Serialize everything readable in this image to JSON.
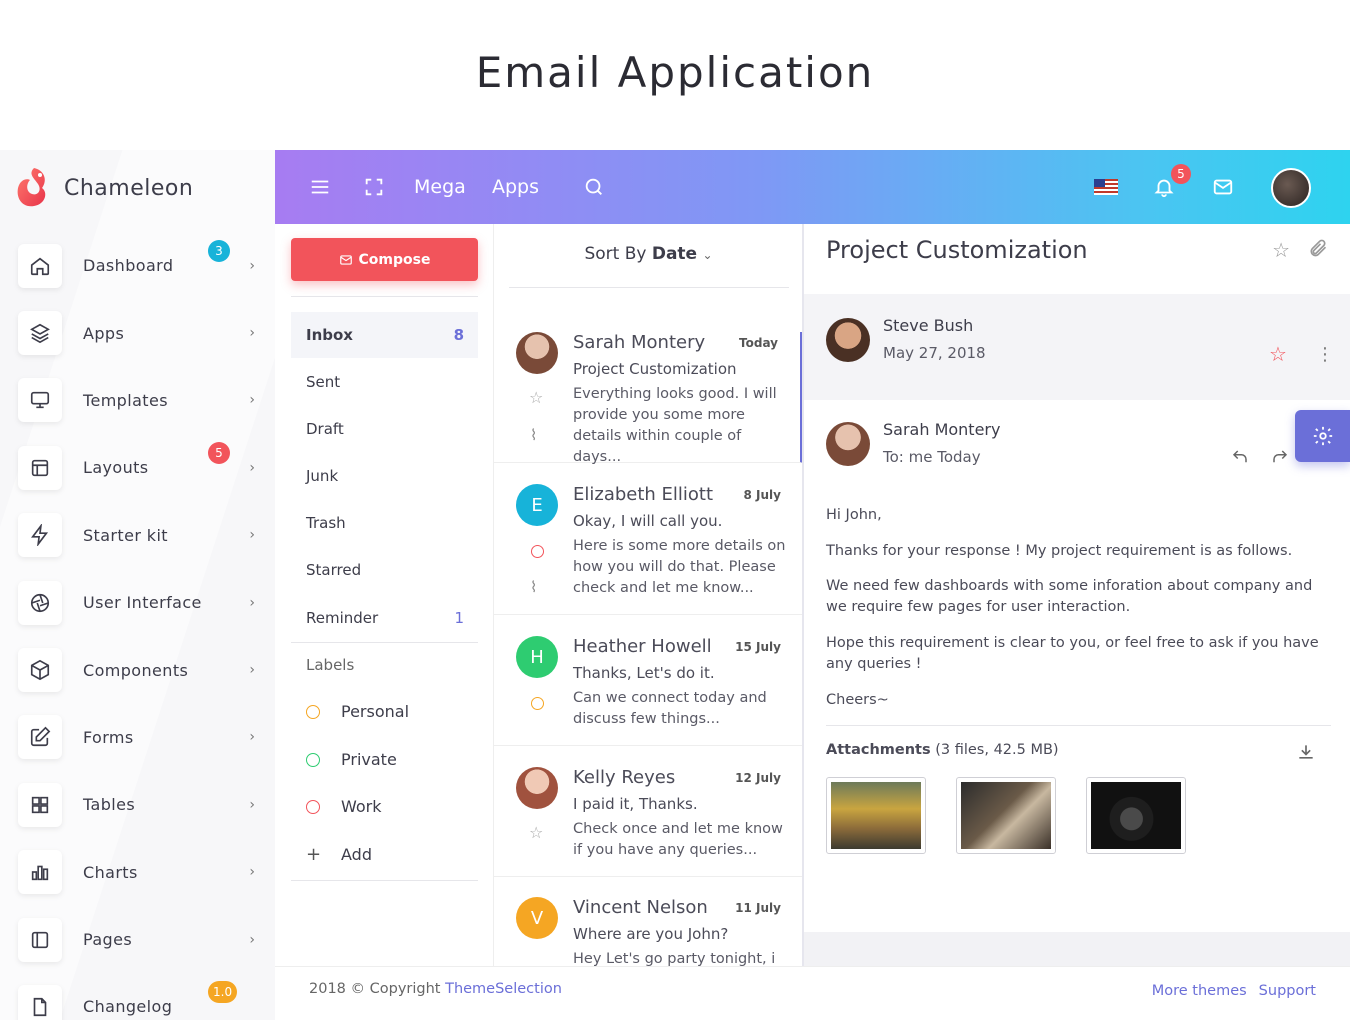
{
  "page_title": "Email Application",
  "brand": {
    "name": "Chameleon"
  },
  "sidebar": {
    "items": [
      {
        "label": "Dashboard",
        "icon": "home-icon",
        "badge": "3",
        "badge_color": "#17b3d9"
      },
      {
        "label": "Apps",
        "icon": "layers-icon",
        "badge": "",
        "badge_color": ""
      },
      {
        "label": "Templates",
        "icon": "monitor-icon",
        "badge": "",
        "badge_color": ""
      },
      {
        "label": "Layouts",
        "icon": "layout-icon",
        "badge": "5",
        "badge_color": "#f2545b"
      },
      {
        "label": "Starter kit",
        "icon": "bolt-icon",
        "badge": "",
        "badge_color": ""
      },
      {
        "label": "User Interface",
        "icon": "aperture-icon",
        "badge": "",
        "badge_color": ""
      },
      {
        "label": "Components",
        "icon": "box-icon",
        "badge": "",
        "badge_color": ""
      },
      {
        "label": "Forms",
        "icon": "edit-icon",
        "badge": "",
        "badge_color": ""
      },
      {
        "label": "Tables",
        "icon": "grid-icon",
        "badge": "",
        "badge_color": ""
      },
      {
        "label": "Charts",
        "icon": "bar-chart-icon",
        "badge": "",
        "badge_color": ""
      },
      {
        "label": "Pages",
        "icon": "sidebar-icon",
        "badge": "",
        "badge_color": ""
      },
      {
        "label": "Changelog",
        "icon": "file-icon",
        "badge": "1.0",
        "badge_color": "#f5a623"
      }
    ]
  },
  "topbar": {
    "mega": "Mega",
    "apps": "Apps",
    "notification_count": "5"
  },
  "folders": {
    "compose": "Compose",
    "items": [
      {
        "label": "Inbox",
        "count": "8"
      },
      {
        "label": "Sent",
        "count": ""
      },
      {
        "label": "Draft",
        "count": ""
      },
      {
        "label": "Junk",
        "count": ""
      },
      {
        "label": "Trash",
        "count": ""
      },
      {
        "label": "Starred",
        "count": ""
      },
      {
        "label": "Reminder",
        "count": "1"
      }
    ],
    "labels_title": "Labels",
    "labels": [
      {
        "label": "Personal",
        "color": "#f5a623"
      },
      {
        "label": "Private",
        "color": "#2ecc71"
      },
      {
        "label": "Work",
        "color": "#f2545b"
      }
    ],
    "add_label": "Add"
  },
  "maillist": {
    "sort_prefix": "Sort By",
    "sort_value": "Date",
    "mails": [
      {
        "name": "Sarah Montery",
        "date": "Today",
        "subject": "Project Customization",
        "preview": "Everything looks good. I will provide you some more details within couple of days...",
        "initial": "",
        "avatar_color": "#c9a48e"
      },
      {
        "name": "Elizabeth Elliott",
        "date": "8 July",
        "subject": "Okay, I will call you.",
        "preview": "Here is some more details on how you will do that. Please check and let me know...",
        "initial": "E",
        "avatar_color": "#17b3d9"
      },
      {
        "name": "Heather Howell",
        "date": "15 July",
        "subject": "Thanks, Let's do it.",
        "preview": "Can we connect today and discuss few things...",
        "initial": "H",
        "avatar_color": "#2ecc71"
      },
      {
        "name": "Kelly Reyes",
        "date": "12 July",
        "subject": "I paid it, Thanks.",
        "preview": "Check once and let me know if you have any queries...",
        "initial": "",
        "avatar_color": "#b9857a"
      },
      {
        "name": "Vincent Nelson",
        "date": "11 July",
        "subject": "Where are you John?",
        "preview": "Hey Let's go party tonight, i",
        "initial": "V",
        "avatar_color": "#f5a623"
      }
    ]
  },
  "reader": {
    "title": "Project Customization",
    "sender": "Steve Bush",
    "sender_date": "May 27, 2018",
    "replier": "Sarah Montery",
    "replier_to": "To: me Today",
    "body": [
      "Hi John,",
      "Thanks for your response ! My project requirement is as follows.",
      "We need few dashboards with some inforation about company and we require few pages for user interaction.",
      "Hope this requirement is clear to you, or feel free to ask if you have any queries !",
      "Cheers~"
    ],
    "attachments_label": "Attachments",
    "attachments_info": "(3 files, 42.5 MB)"
  },
  "footer": {
    "copyright": "2018 © Copyright",
    "company": "ThemeSelection",
    "more_themes": "More themes",
    "support": "Support"
  },
  "colors": {
    "accent": "#6b6fd8",
    "danger": "#f2545b",
    "gradient_start": "#a77cf2",
    "gradient_end": "#2ed3ef"
  }
}
